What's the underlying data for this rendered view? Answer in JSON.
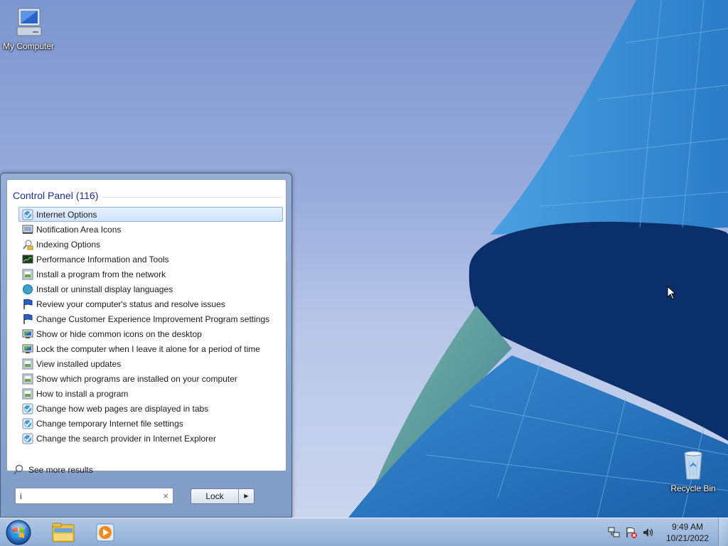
{
  "desktop": {
    "icons": [
      {
        "label": "My Computer",
        "icon": "my-computer-icon"
      },
      {
        "label": "Recycle Bin",
        "icon": "recycle-bin-icon"
      }
    ]
  },
  "start_menu": {
    "group_title": "Control Panel (116)",
    "results": [
      {
        "label": "Internet Options",
        "icon": "internet-options-icon",
        "selected": true
      },
      {
        "label": "Notification Area Icons",
        "icon": "notification-area-icon"
      },
      {
        "label": "Indexing Options",
        "icon": "indexing-options-icon"
      },
      {
        "label": "Performance Information and Tools",
        "icon": "performance-icon"
      },
      {
        "label": "Install a program from the network",
        "icon": "programs-icon"
      },
      {
        "label": "Install or uninstall display languages",
        "icon": "globe-icon"
      },
      {
        "label": "Review your computer's status and resolve issues",
        "icon": "action-center-flag-icon"
      },
      {
        "label": "Change Customer Experience Improvement Program settings",
        "icon": "action-center-flag-icon"
      },
      {
        "label": "Show or hide common icons on the desktop",
        "icon": "display-icon"
      },
      {
        "label": "Lock the computer when I leave it alone for a period of time",
        "icon": "display-icon"
      },
      {
        "label": "View installed updates",
        "icon": "programs-icon"
      },
      {
        "label": "Show which programs are installed on your computer",
        "icon": "programs-icon"
      },
      {
        "label": "How to install a program",
        "icon": "programs-icon"
      },
      {
        "label": "Change how web pages are displayed in tabs",
        "icon": "internet-options-icon"
      },
      {
        "label": "Change temporary Internet file settings",
        "icon": "internet-options-icon"
      },
      {
        "label": "Change the search provider in Internet Explorer",
        "icon": "internet-options-icon"
      }
    ],
    "see_more": "See more results",
    "search_value": "i",
    "clear_symbol": "×",
    "power_button_label": "Lock",
    "power_arrow": "▶"
  },
  "taskbar": {
    "pinned": [
      {
        "name": "windows-explorer-icon"
      },
      {
        "name": "media-player-icon"
      }
    ],
    "clock": {
      "time": "9:49 AM",
      "date": "10/21/2022"
    }
  }
}
